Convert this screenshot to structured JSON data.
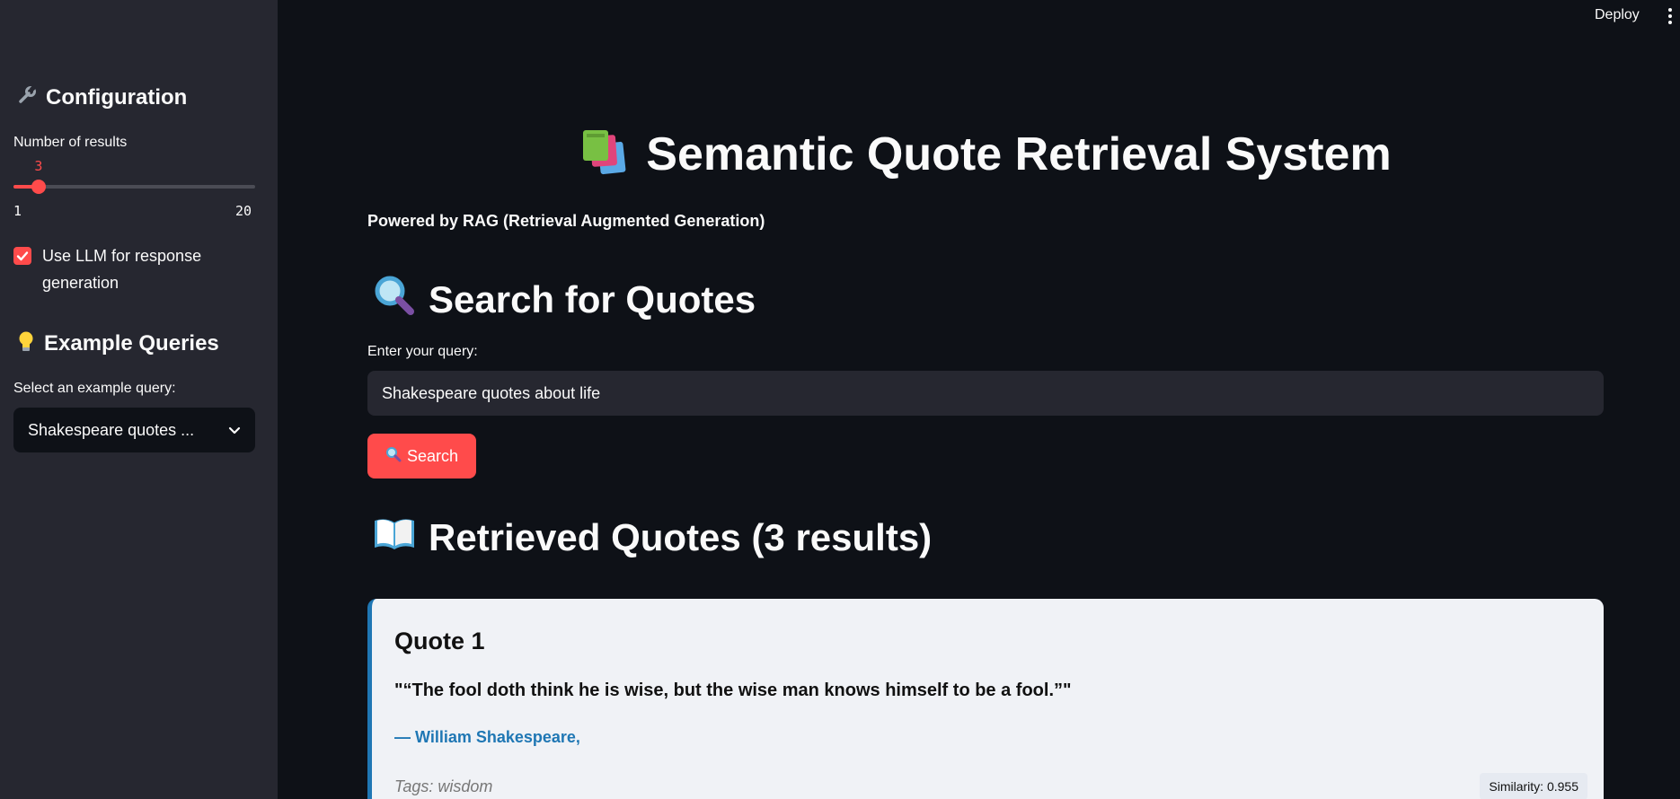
{
  "topbar": {
    "deploy_label": "Deploy"
  },
  "sidebar": {
    "config_heading": "Configuration",
    "config_icon": "wrench-icon",
    "slider": {
      "label": "Number of results",
      "value": "3",
      "min": "1",
      "max": "20"
    },
    "llm_checkbox": {
      "label": "Use LLM for response generation",
      "checked": true
    },
    "examples_heading": "Example Queries",
    "examples_icon": "lightbulb-icon",
    "select": {
      "label": "Select an example query:",
      "value": "Shakespeare quotes ..."
    }
  },
  "main": {
    "title": "Semantic Quote Retrieval System",
    "title_icon": "books-icon",
    "subtitle": "Powered by RAG (Retrieval Augmented Generation)",
    "search_heading": "Search for Quotes",
    "search_icon": "magnifier-icon",
    "query_label": "Enter your query:",
    "query_value": "Shakespeare quotes about life",
    "search_button": "Search",
    "results_heading": "Retrieved Quotes (3 results)",
    "results_icon": "open-book-icon",
    "results": [
      {
        "title": "Quote 1",
        "quote": "\"“The fool doth think he is wise, but the wise man knows himself to be a fool.”\"",
        "author": "— William Shakespeare,",
        "tags": "Tags: wisdom",
        "similarity": "Similarity: 0.955"
      }
    ]
  },
  "colors": {
    "accent": "#ff4b4b",
    "background": "#0e1117",
    "sidebar": "#262730",
    "card": "#f0f2f6",
    "author": "#1f77b4"
  }
}
